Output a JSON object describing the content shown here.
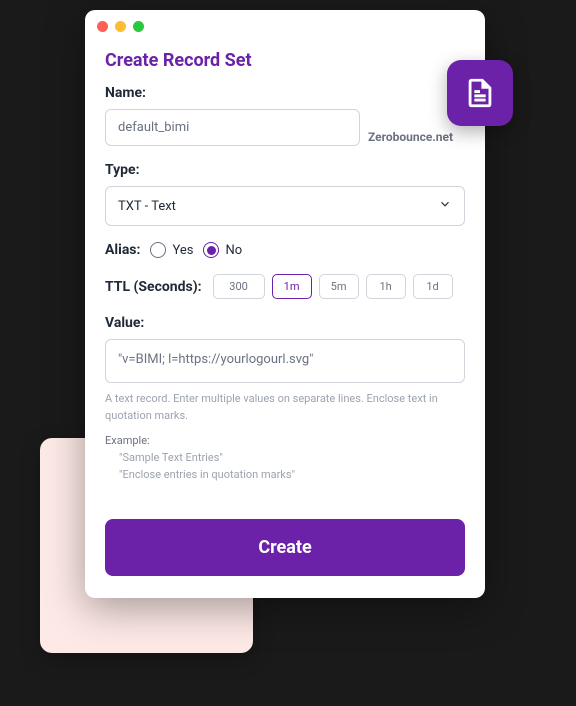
{
  "header": {
    "title": "Create Record Set"
  },
  "name": {
    "label": "Name:",
    "value": "default_bimi",
    "suffix": "Zerobounce.net"
  },
  "type": {
    "label": "Type:",
    "selected": "TXT - Text"
  },
  "alias": {
    "label": "Alias:",
    "yes": "Yes",
    "no": "No",
    "selected": "no"
  },
  "ttl": {
    "label": "TTL (Seconds):",
    "value": "300",
    "presets": [
      "1m",
      "5m",
      "1h",
      "1d"
    ],
    "active": "1m"
  },
  "value": {
    "label": "Value:",
    "text": "\"v=BIMI; l=https://yourlogourl.svg\"",
    "help": "A text record. Enter multiple values on separate lines. Enclose text in quotation marks.",
    "example_label": "Example:",
    "example1": "\"Sample Text Entries\"",
    "example2": "\"Enclose entries in quotation marks\""
  },
  "actions": {
    "create": "Create"
  }
}
